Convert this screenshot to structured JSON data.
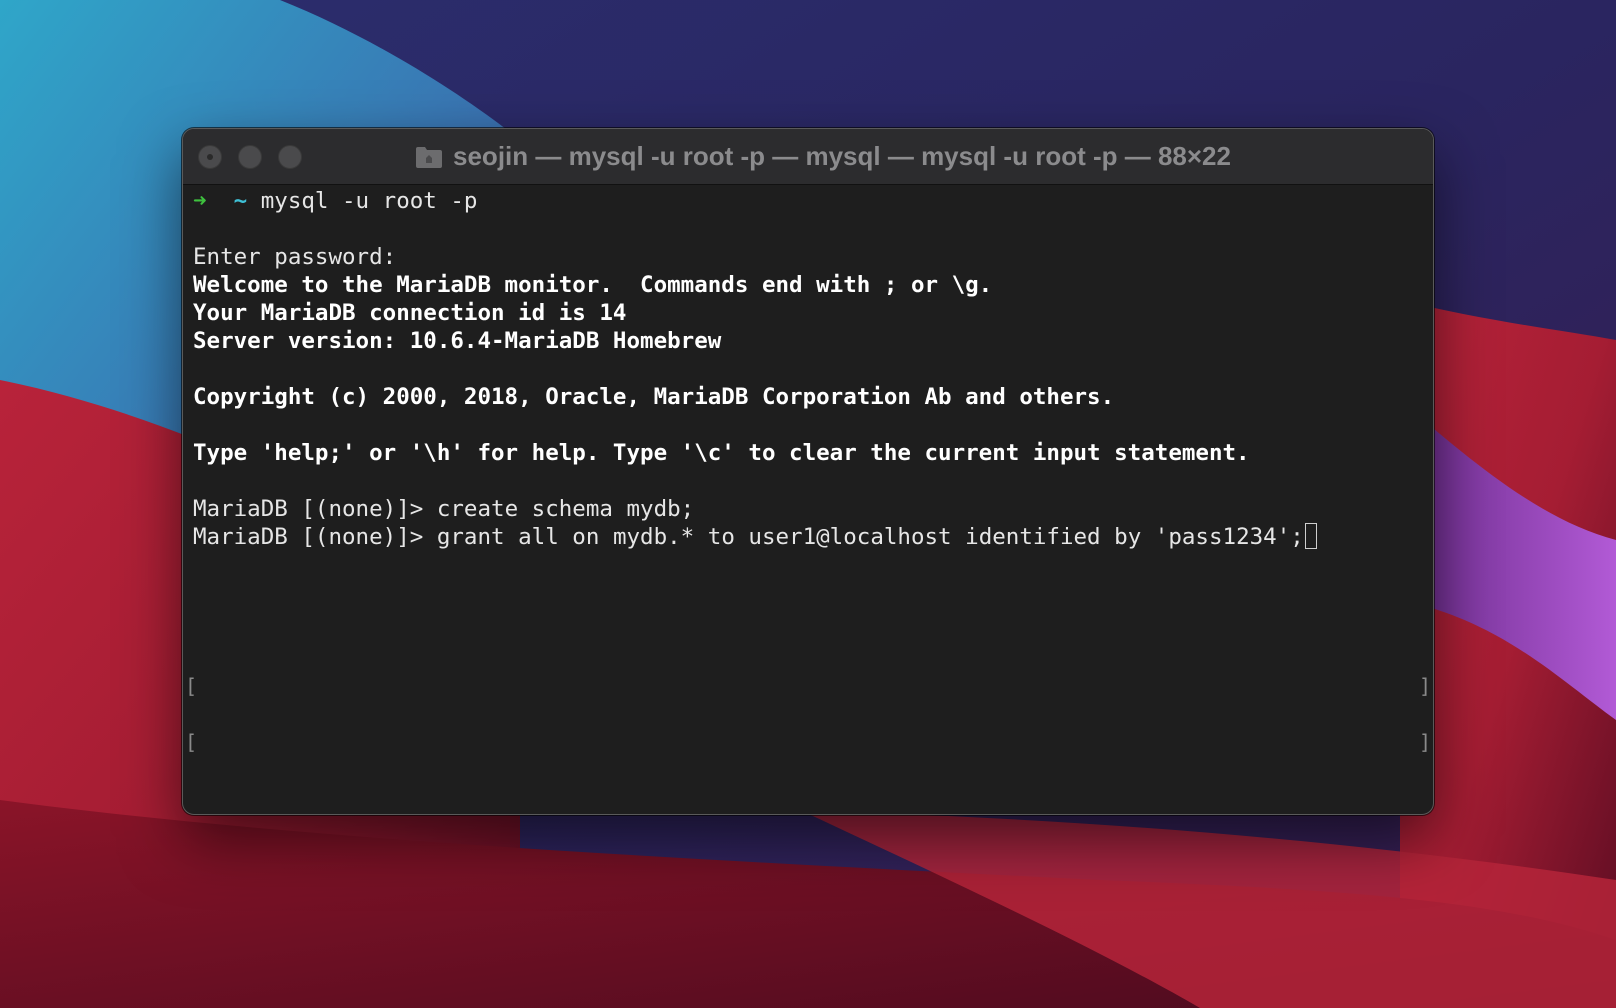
{
  "window": {
    "title": "seojin — mysql -u root -p — mysql — mysql -u root -p — 88×22",
    "folder_icon": "folder-icon"
  },
  "colors": {
    "terminal_bg": "#1e1e1e",
    "prompt_arrow": "#3ec13e",
    "prompt_tilde": "#3fc1d6",
    "text": "#e6e6e6"
  },
  "terminal": {
    "prompt_arrow": "➜",
    "prompt_tilde": "~",
    "prompt_command": "mysql -u root -p",
    "enter_password": "Enter password:",
    "welcome": "Welcome to the MariaDB monitor.  Commands end with ; or \\g.",
    "connection_id": "Your MariaDB connection id is 14",
    "server_version": "Server version: 10.6.4-MariaDB Homebrew",
    "copyright": "Copyright (c) 2000, 2018, Oracle, MariaDB Corporation Ab and others.",
    "help": "Type 'help;' or '\\h' for help. Type '\\c' to clear the current input statement.",
    "cmd1_prompt": "MariaDB [(none)]> ",
    "cmd1": "create schema mydb;",
    "cmd2_prompt": "MariaDB [(none)]> ",
    "cmd2": "grant all on mydb.* to user1@localhost identified by 'pass1234';",
    "bracket_left": "[",
    "bracket_right": "]"
  }
}
